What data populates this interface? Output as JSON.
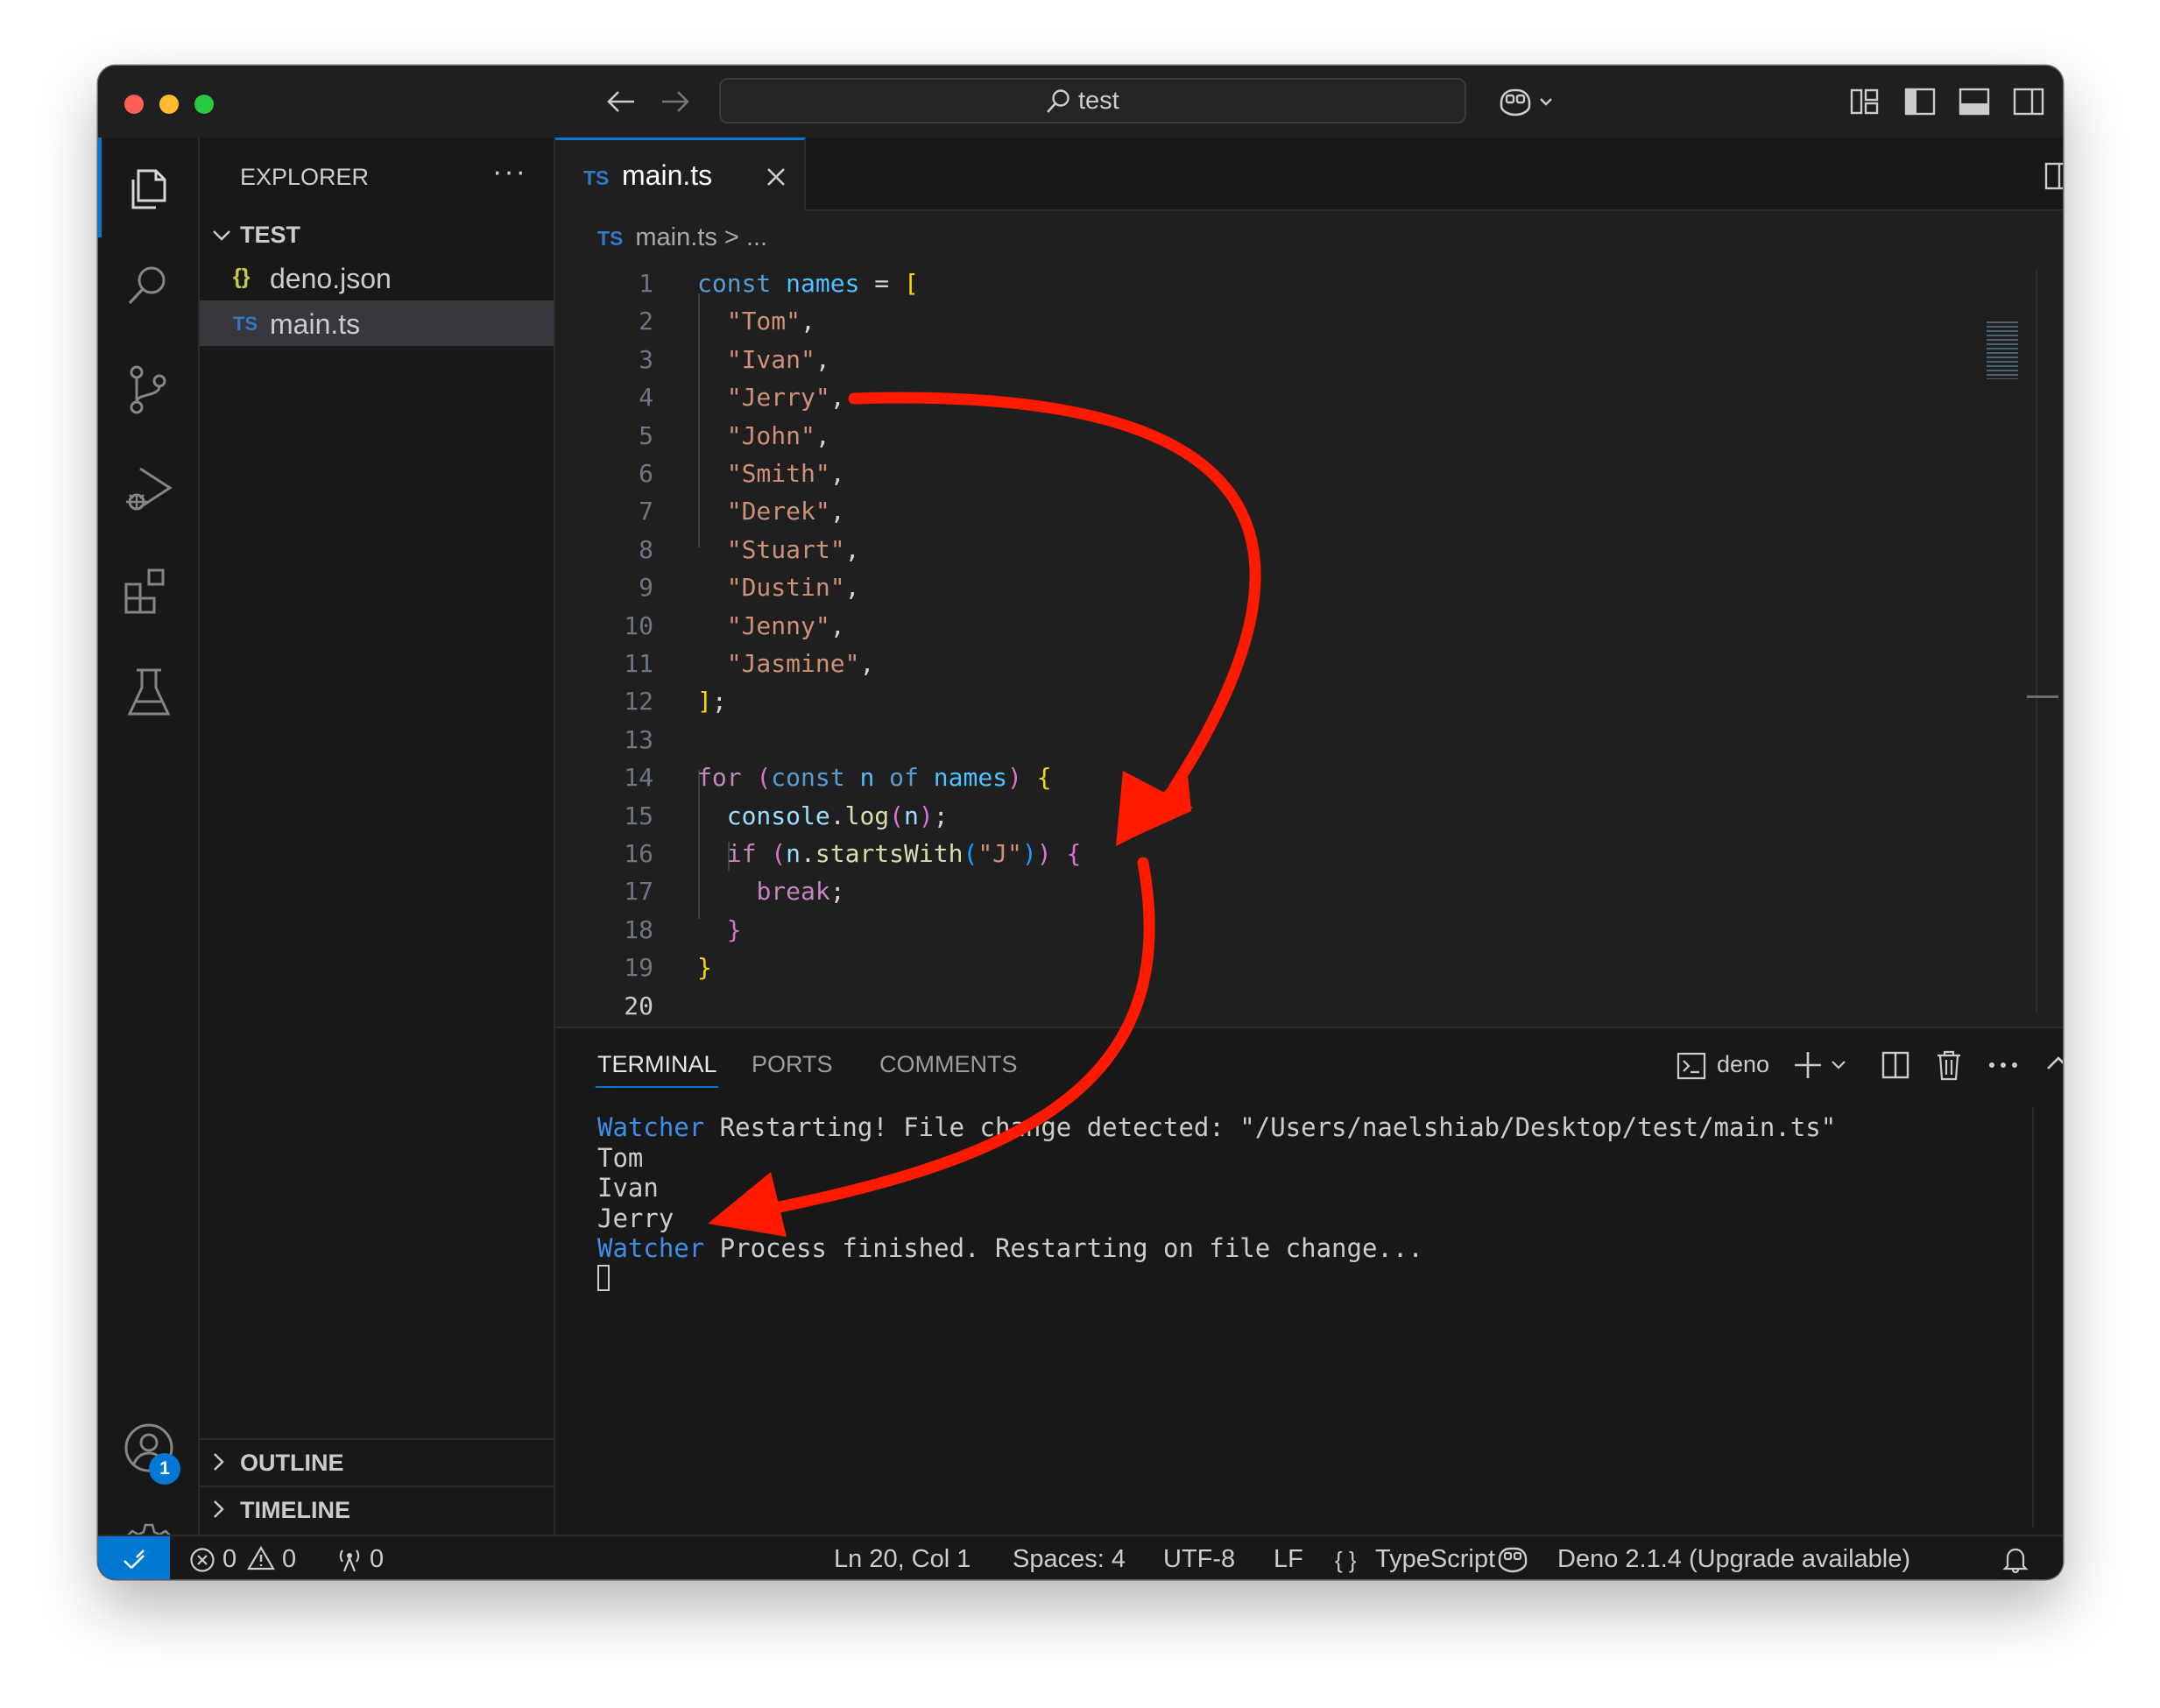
{
  "window": {
    "search_text": "test"
  },
  "explorer": {
    "title": "EXPLORER",
    "more": "···",
    "folder": "TEST",
    "files": [
      {
        "icon": "{}",
        "name": "deno.json",
        "icon_color": "#cbcb41"
      },
      {
        "icon": "TS",
        "name": "main.ts",
        "icon_color": "#3178c6",
        "selected": true
      }
    ],
    "sections": [
      "OUTLINE",
      "TIMELINE"
    ]
  },
  "accounts_badge": "1",
  "editor": {
    "tab_lang": "TS",
    "tab_name": "main.ts",
    "breadcrumb_file": "main.ts",
    "breadcrumb_rest": "...",
    "line_numbers": [
      "1",
      "2",
      "3",
      "4",
      "5",
      "6",
      "7",
      "8",
      "9",
      "10",
      "11",
      "12",
      "13",
      "14",
      "15",
      "16",
      "17",
      "18",
      "19",
      "20"
    ],
    "current_line": 20,
    "lines": [
      [
        [
          "kw",
          "const"
        ],
        [
          "op",
          " "
        ],
        [
          "con",
          "names"
        ],
        [
          "op",
          " = "
        ],
        [
          "p1",
          "["
        ]
      ],
      [
        [
          "op",
          "  "
        ],
        [
          "str",
          "\"Tom\""
        ],
        [
          "op",
          ","
        ]
      ],
      [
        [
          "op",
          "  "
        ],
        [
          "str",
          "\"Ivan\""
        ],
        [
          "op",
          ","
        ]
      ],
      [
        [
          "op",
          "  "
        ],
        [
          "str",
          "\"Jerry\""
        ],
        [
          "op",
          ","
        ]
      ],
      [
        [
          "op",
          "  "
        ],
        [
          "str",
          "\"John\""
        ],
        [
          "op",
          ","
        ]
      ],
      [
        [
          "op",
          "  "
        ],
        [
          "str",
          "\"Smith\""
        ],
        [
          "op",
          ","
        ]
      ],
      [
        [
          "op",
          "  "
        ],
        [
          "str",
          "\"Derek\""
        ],
        [
          "op",
          ","
        ]
      ],
      [
        [
          "op",
          "  "
        ],
        [
          "str",
          "\"Stuart\""
        ],
        [
          "op",
          ","
        ]
      ],
      [
        [
          "op",
          "  "
        ],
        [
          "str",
          "\"Dustin\""
        ],
        [
          "op",
          ","
        ]
      ],
      [
        [
          "op",
          "  "
        ],
        [
          "str",
          "\"Jenny\""
        ],
        [
          "op",
          ","
        ]
      ],
      [
        [
          "op",
          "  "
        ],
        [
          "str",
          "\"Jasmine\""
        ],
        [
          "op",
          ","
        ]
      ],
      [
        [
          "p1",
          "]"
        ],
        [
          "op",
          ";"
        ]
      ],
      [],
      [
        [
          "ctl",
          "for"
        ],
        [
          "op",
          " "
        ],
        [
          "p2",
          "("
        ],
        [
          "kw",
          "const"
        ],
        [
          "op",
          " "
        ],
        [
          "con",
          "n"
        ],
        [
          "op",
          " "
        ],
        [
          "kw",
          "of"
        ],
        [
          "op",
          " "
        ],
        [
          "con",
          "names"
        ],
        [
          "p2",
          ")"
        ],
        [
          "op",
          " "
        ],
        [
          "p1",
          "{"
        ]
      ],
      [
        [
          "op",
          "  "
        ],
        [
          "var",
          "console"
        ],
        [
          "op",
          "."
        ],
        [
          "fn",
          "log"
        ],
        [
          "p2",
          "("
        ],
        [
          "var",
          "n"
        ],
        [
          "p2",
          ")"
        ],
        [
          "op",
          ";"
        ]
      ],
      [
        [
          "op",
          "  "
        ],
        [
          "ctl",
          "if"
        ],
        [
          "op",
          " "
        ],
        [
          "p2",
          "("
        ],
        [
          "var",
          "n"
        ],
        [
          "op",
          "."
        ],
        [
          "fn",
          "startsWith"
        ],
        [
          "p3",
          "("
        ],
        [
          "str",
          "\"J\""
        ],
        [
          "p3",
          ")"
        ],
        [
          "p2",
          ")"
        ],
        [
          "op",
          " "
        ],
        [
          "p2",
          "{"
        ]
      ],
      [
        [
          "op",
          "    "
        ],
        [
          "ctl",
          "break"
        ],
        [
          "op",
          ";"
        ]
      ],
      [
        [
          "op",
          "  "
        ],
        [
          "p2",
          "}"
        ]
      ],
      [
        [
          "p1",
          "}"
        ]
      ],
      []
    ]
  },
  "panel": {
    "tabs": [
      "TERMINAL",
      "PORTS",
      "COMMENTS"
    ],
    "active_tab": "TERMINAL",
    "terminal_name": "deno",
    "output": [
      {
        "tag": "Watcher",
        "text": " Restarting! File change detected: \"/Users/naelshiab/Desktop/test/main.ts\""
      },
      {
        "tag": "",
        "text": "Tom"
      },
      {
        "tag": "",
        "text": "Ivan"
      },
      {
        "tag": "",
        "text": "Jerry"
      },
      {
        "tag": "Watcher",
        "text": " Process finished. Restarting on file change..."
      }
    ]
  },
  "status_bar": {
    "errors": "0",
    "warnings": "0",
    "ports": "0",
    "position": "Ln 20, Col 1",
    "spaces": "Spaces: 4",
    "encoding": "UTF-8",
    "eol": "LF",
    "language": "TypeScript",
    "deno": "Deno 2.1.4 (Upgrade available)"
  },
  "colors": {
    "accent": "#0078d4",
    "annotation_arrow": "#ff1a00"
  }
}
